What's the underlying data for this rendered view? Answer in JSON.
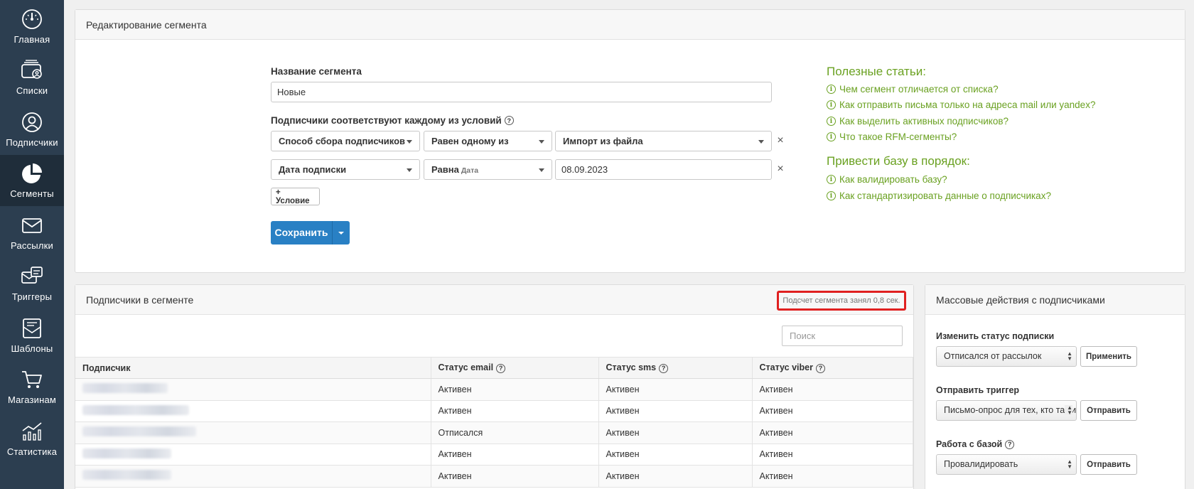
{
  "sidebar": {
    "items": [
      {
        "label": "Главная",
        "icon": "dashboard-gauge-icon"
      },
      {
        "label": "Списки",
        "icon": "lists-icon"
      },
      {
        "label": "Подписчики",
        "icon": "user-circle-icon"
      },
      {
        "label": "Сегменты",
        "icon": "pie-chart-icon",
        "active": true
      },
      {
        "label": "Рассылки",
        "icon": "envelope-icon"
      },
      {
        "label": "Триггеры",
        "icon": "triggers-icon"
      },
      {
        "label": "Шаблоны",
        "icon": "templates-icon"
      },
      {
        "label": "Магазинам",
        "icon": "cart-icon"
      },
      {
        "label": "Статистика",
        "icon": "stats-icon"
      }
    ]
  },
  "segment_editor": {
    "title": "Редактирование сегмента",
    "name_label": "Название сегмента",
    "name_value": "Новые",
    "conditions_label": "Подписчики соответствуют каждому из условий",
    "conditions": [
      {
        "field": "Способ сбора подписчиков",
        "operator": "Равен одному из",
        "operator_sub": "",
        "value": "Импорт из файла"
      },
      {
        "field": "Дата подписки",
        "operator": "Равна",
        "operator_sub": "Дата",
        "value": "08.09.2023"
      }
    ],
    "add_condition_label": "+ Условие",
    "save_label": "Сохранить"
  },
  "help": {
    "useful_title": "Полезные статьи:",
    "useful_links": [
      "Чем сегмент отличается от списка?",
      "Как отправить письма только на адреса mail или yandex?",
      "Как выделить активных подписчиков?",
      "Что такое RFM-сегменты?"
    ],
    "cleanup_title": "Привести базу в порядок:",
    "cleanup_links": [
      "Как валидировать базу?",
      "Как стандартизировать данные о подписчиках?"
    ]
  },
  "subscribers": {
    "title": "Подписчики в сегменте",
    "timing": "Подсчет сегмента занял 0,8 сек.",
    "search_placeholder": "Поиск",
    "columns": [
      "Подписчик",
      "Статус email",
      "Статус sms",
      "Статус viber"
    ],
    "rows": [
      {
        "email": "Активен",
        "sms": "Активен",
        "viber": "Активен"
      },
      {
        "email": "Активен",
        "sms": "Активен",
        "viber": "Активен"
      },
      {
        "email": "Отписался",
        "sms": "Активен",
        "viber": "Активен"
      },
      {
        "email": "Активен",
        "sms": "Активен",
        "viber": "Активен"
      },
      {
        "email": "Активен",
        "sms": "Активен",
        "viber": "Активен"
      }
    ]
  },
  "mass_actions": {
    "title": "Массовые действия с подписчиками",
    "groups": [
      {
        "label": "Изменить статус подписки",
        "select": "Отписался от рассылок",
        "button": "Применить",
        "help": false
      },
      {
        "label": "Отправить триггер",
        "select": "Письмо-опрос для тех, кто так и не",
        "button": "Отправить",
        "help": false
      },
      {
        "label": "Работа с базой",
        "select": "Провалидировать",
        "button": "Отправить",
        "help": true
      }
    ]
  },
  "colors": {
    "sidebar_bg": "#2c3e50",
    "accent_blue": "#2980c4",
    "link_green": "#6aa121",
    "highlight_red": "#e02020"
  }
}
